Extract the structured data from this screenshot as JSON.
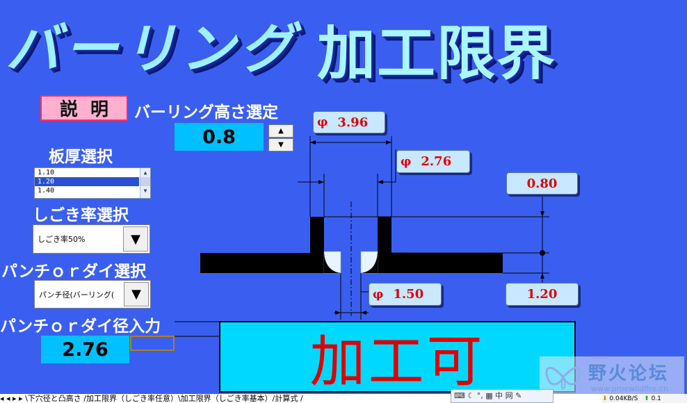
{
  "title": {
    "kana": "バーリング",
    "kanji": "加工限界"
  },
  "explain_button": "説明",
  "burring_height": {
    "label": "バーリング高さ選定",
    "value": "0.8"
  },
  "thickness": {
    "label": "板厚選択",
    "options": [
      "1.10",
      "1.20",
      "1.40"
    ],
    "selected_index": 1
  },
  "ironing": {
    "label": "しごき率選択",
    "value": "しごき率50%"
  },
  "punch_die": {
    "label": "パンチｏｒダイ選択",
    "value": "パンチ径(バーリング("
  },
  "punch_die_input": {
    "label": "パンチｏｒダイ径入力",
    "value": "2.76"
  },
  "dimensions": {
    "outer_diameter": "3.96",
    "inner_diameter": "2.76",
    "height": "0.80",
    "hole_diameter": "1.50",
    "thickness": "1.20",
    "phi_symbol": "φ"
  },
  "result": "加工可",
  "watermark": {
    "name": "野火论坛",
    "url": "www.proewildfire.cn"
  },
  "sheet_tabs": "◂ ◂ ▸ ▸ \\下穴径と凸高さ /加工限界（しごき率任意）\\加工限界（しごき率基本）/計算式 /",
  "tray": "⌨ ☾ °, ▦ 中 网 ✎",
  "netstat": {
    "down": "0.04KB/S",
    "up": "0.1"
  },
  "colors": {
    "background": "#3a5ff0",
    "value_box": "#00c0ff",
    "result_text": "#e00000",
    "callout_bg": "#c8e8ff"
  }
}
